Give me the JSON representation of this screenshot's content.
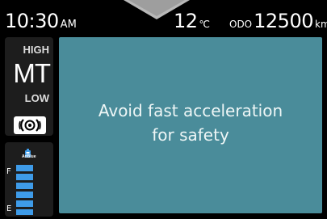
{
  "status": {
    "time": "10:30",
    "ampm": "AM",
    "temperature": "12",
    "temperature_unit": "℃",
    "odo_label": "ODO",
    "odo_value": "12500",
    "odo_unit": "km"
  },
  "transmission": {
    "high_label": "HIGH",
    "mode_label": "MT",
    "low_label": "LOW",
    "indicator_icon": "diff-lock-icon"
  },
  "fuel_gauge": {
    "icon": "adblue-icon",
    "label": "AdBlue",
    "full_label": "F",
    "empty_label": "E",
    "level": 1.0
  },
  "message": {
    "lines": [
      "Avoid fast acceleration",
      "for safety"
    ]
  },
  "colors": {
    "message_background": "#4a8c9a",
    "gauge_bar": "#3e9be8",
    "panel": "#1d1d1d"
  }
}
